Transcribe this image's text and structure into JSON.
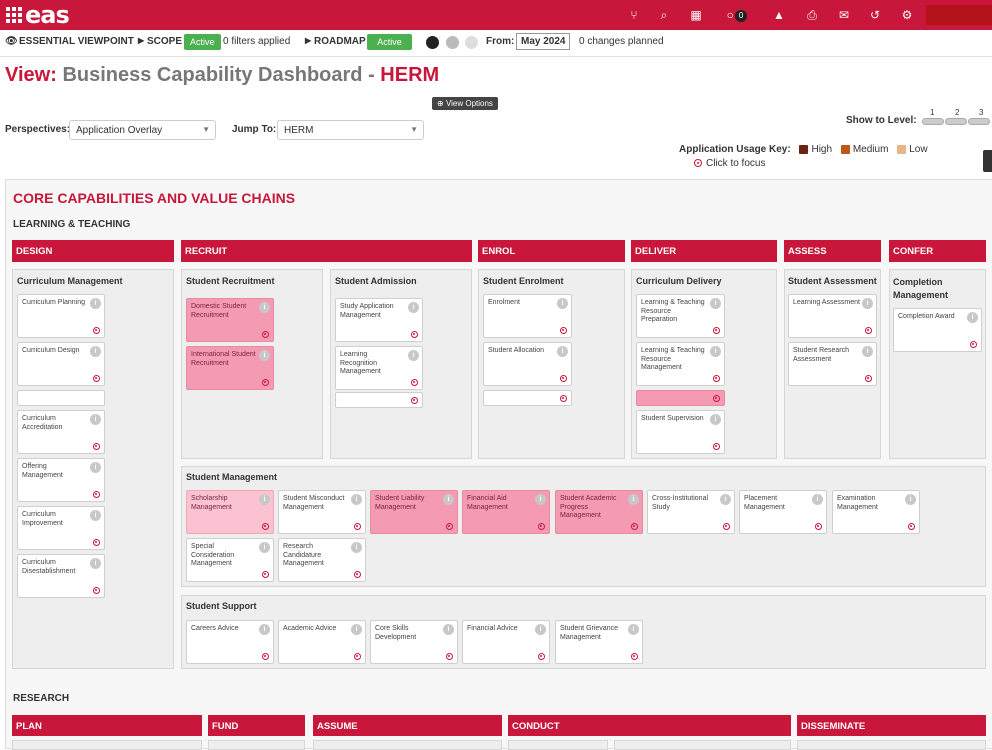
{
  "app": {
    "logo_text": "eas",
    "comment_count": "0"
  },
  "toolbar": {
    "viewpoint": "ESSENTIAL VIEWPOINT",
    "scope_label": "SCOPE",
    "scope_status": "Active",
    "filters": "0 filters applied",
    "roadmap_label": "ROADMAP",
    "roadmap_status": "Active",
    "from_label": "From:",
    "from_value": "May 2024",
    "changes": "0 changes planned"
  },
  "page": {
    "title_prefix": "View:",
    "title_main": "Business Capability Dashboard -",
    "title_suffix": "HERM",
    "view_options": "View Options",
    "perspectives_label": "Perspectives:",
    "perspectives_value": "Application Overlay",
    "jump_label": "Jump To:",
    "jump_value": "HERM",
    "show_level_label": "Show to Level:",
    "levels": [
      "1",
      "2",
      "3"
    ],
    "usage_key_label": "Application Usage Key:",
    "usage_key": [
      {
        "label": "High",
        "color": "#6b2410"
      },
      {
        "label": "Medium",
        "color": "#c0561a"
      },
      {
        "label": "Low",
        "color": "#e8b48c"
      }
    ],
    "click_focus": "Click to focus"
  },
  "main": {
    "section_title": "CORE CAPABILITIES AND VALUE CHAINS",
    "group1": "LEARNING & TEACHING",
    "group2": "RESEARCH",
    "value_chains": [
      "DESIGN",
      "RECRUIT",
      "ENROL",
      "DELIVER",
      "ASSESS",
      "CONFER"
    ],
    "research_chains": [
      "PLAN",
      "FUND",
      "ASSUME",
      "CONDUCT",
      "DISSEMINATE"
    ],
    "columns": {
      "curriculum_mgmt": "Curriculum Management",
      "student_recruitment": "Student Recruitment",
      "student_admission": "Student Admission",
      "student_enrolment": "Student Enrolment",
      "curriculum_delivery": "Curriculum Delivery",
      "student_assessment": "Student Assessment",
      "completion_mgmt": "Completion Management",
      "student_management": "Student Management",
      "student_support": "Student Support"
    },
    "caps": {
      "curr_planning": "Curriculum Planning",
      "curr_design": "Curriculum Design",
      "curr_accreditation": "Curriculum Accreditation",
      "offering_mgmt": "Offering Management",
      "curr_improvement": "Curriculum Improvement",
      "curr_disestablishment": "Curriculum Disestablishment",
      "domestic_recruit": "Domestic Student Recruitment",
      "intl_recruit": "International Student Recruitment",
      "study_app": "Study Application Management",
      "learning_recog": "Learning Recognition Management",
      "enrolment": "Enrolment",
      "student_alloc": "Student Allocation",
      "lt_prep": "Learning & Teaching Resource Preparation",
      "lt_mgmt": "Learning & Teaching Resource Management",
      "student_supervision": "Student Supervision",
      "learning_assess": "Learning Assessment",
      "research_assess": "Student Research Assessment",
      "completion_award": "Completion Award",
      "scholarship": "Scholarship Management",
      "misconduct": "Student Misconduct Management",
      "liability": "Student Liability Management",
      "financial_aid": "Financial Aid Management",
      "academic_progress": "Student Academic Progress Management",
      "cross_inst": "Cross-Institutional Study",
      "placement": "Placement Management",
      "examination": "Examination Management",
      "special_consid": "Special Consideration Management",
      "research_candid": "Research Candidature Management",
      "careers": "Careers Advice",
      "academic_advice": "Academic Advice",
      "core_skills": "Core Skills Development",
      "fin_advice": "Financial Advice",
      "grievance": "Student Grievance Management"
    }
  },
  "colors": {
    "brand": "#c8173a",
    "active": "#4caf50",
    "highlight": "#f49ab3"
  }
}
